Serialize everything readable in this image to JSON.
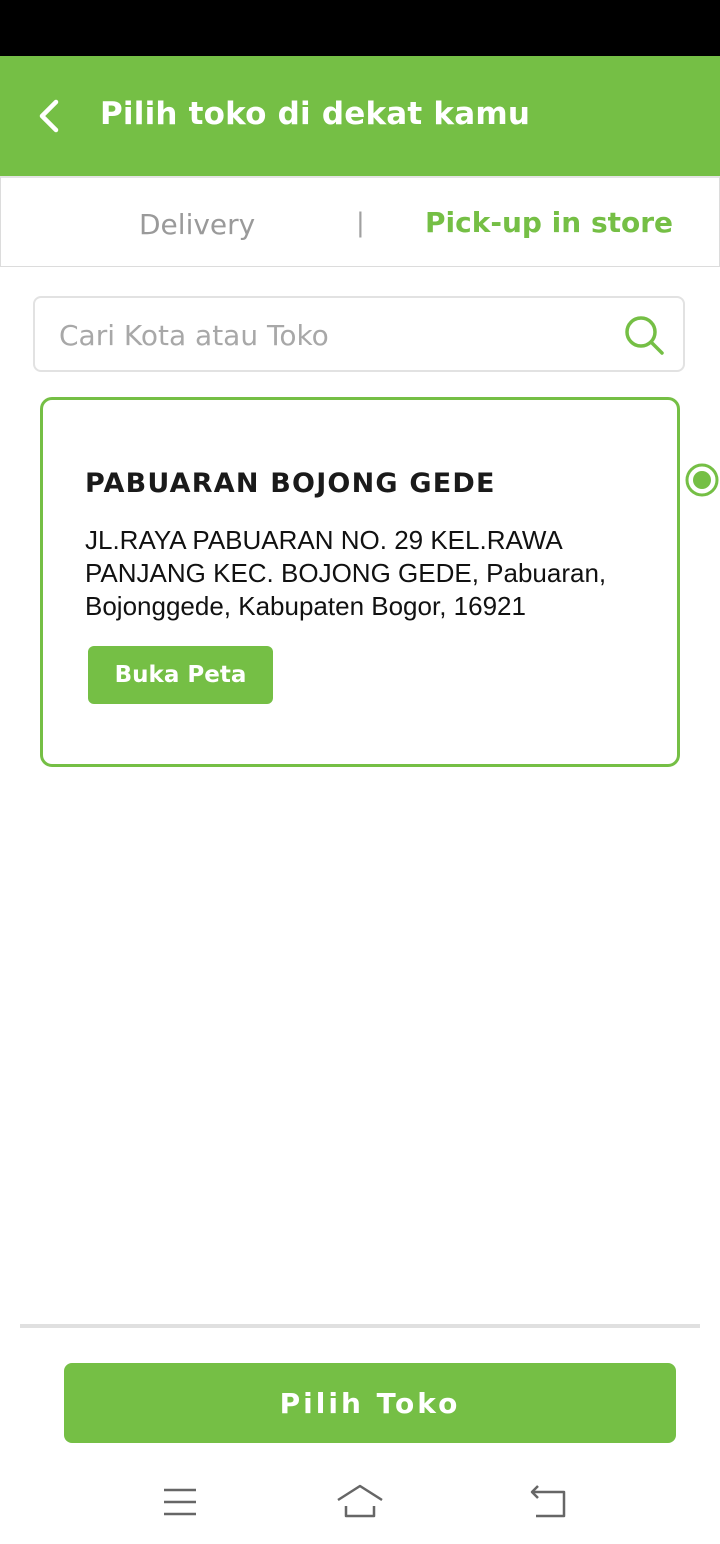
{
  "header": {
    "title": "Pilih toko di dekat kamu",
    "back_icon": "chevron-left-icon"
  },
  "tabs": {
    "items": [
      {
        "label": "Delivery",
        "active": false
      },
      {
        "label": "Pick-up in store",
        "active": true
      }
    ],
    "separator": "|"
  },
  "search": {
    "placeholder": "Cari Kota atau Toko",
    "value": "",
    "icon": "search-icon"
  },
  "stores": [
    {
      "name": "PABUARAN BOJONG GEDE",
      "address": "JL.RAYA PABUARAN NO. 29 KEL.RAWA PANJANG KEC. BOJONG GEDE, Pabuaran, Bojonggede, Kabupaten Bogor, 16921",
      "map_button_label": "Buka Peta",
      "selected": true
    }
  ],
  "footer": {
    "primary_button_label": "Pilih Toko"
  },
  "system_nav": {
    "icons": [
      "menu-icon",
      "home-icon",
      "back-icon"
    ]
  },
  "colors": {
    "brand_green": "#75bf45",
    "status_bar": "#000000"
  }
}
